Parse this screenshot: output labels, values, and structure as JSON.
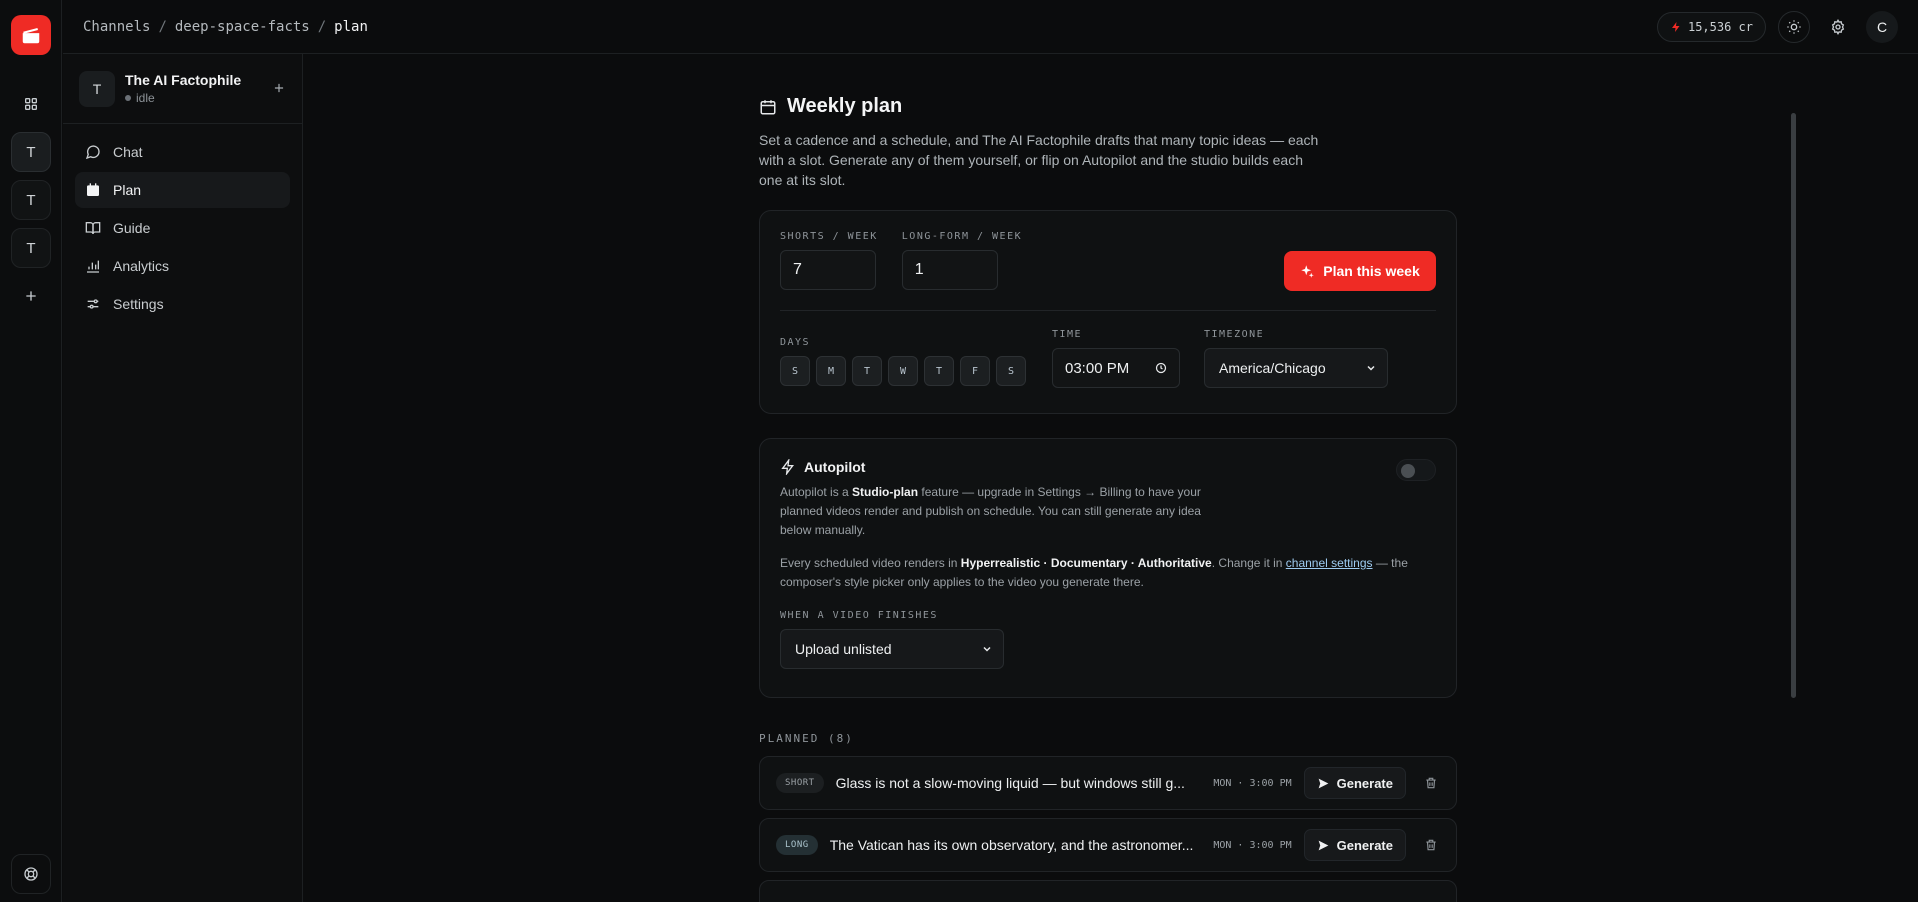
{
  "rail": {
    "items": [
      {
        "label": ""
      },
      {
        "label": "T"
      },
      {
        "label": "T"
      },
      {
        "label": "T"
      }
    ]
  },
  "header": {
    "breadcrumb": [
      "Channels",
      "deep-space-facts",
      "plan"
    ],
    "separator": "/",
    "credits": "15,536 cr",
    "avatar_initial": "C"
  },
  "sidebar": {
    "channel": {
      "initial": "T",
      "name": "The AI Factophile",
      "status": "idle"
    },
    "nav": [
      {
        "label": "Chat",
        "icon": "chat-icon"
      },
      {
        "label": "Plan",
        "icon": "calendar-icon",
        "active": true
      },
      {
        "label": "Guide",
        "icon": "book-icon"
      },
      {
        "label": "Analytics",
        "icon": "bar-chart-icon"
      },
      {
        "label": "Settings",
        "icon": "sliders-icon"
      }
    ]
  },
  "main": {
    "title": "Weekly plan",
    "description": "Set a cadence and a schedule, and The AI Factophile drafts that many topic ideas — each with a slot. Generate any of them yourself, or flip on Autopilot and the studio builds each one at its slot.",
    "cadence": {
      "shorts_label": "SHORTS / WEEK",
      "shorts_value": "7",
      "longform_label": "LONG-FORM / WEEK",
      "longform_value": "1",
      "plan_button": "Plan this week"
    },
    "schedule": {
      "days_label": "DAYS",
      "days": [
        "S",
        "M",
        "T",
        "W",
        "T",
        "F",
        "S"
      ],
      "time_label": "TIME",
      "time_value": "03:00 PM",
      "timezone_label": "TIMEZONE",
      "timezone_value": "America/Chicago"
    },
    "autopilot": {
      "title": "Autopilot",
      "text_pre": "Autopilot is a ",
      "text_bold": "Studio-plan",
      "text_post": " feature — upgrade in Settings → Billing to have your planned videos render and publish on schedule. You can still generate any idea below manually.",
      "style_pre": "Every scheduled video renders in ",
      "style_bold": "Hyperrealistic · Documentary · Authoritative",
      "style_mid": ". Change it in ",
      "style_link": "channel settings",
      "style_post": " — the composer's style picker only applies to the video you generate there.",
      "finish_label": "WHEN A VIDEO FINISHES",
      "finish_value": "Upload unlisted",
      "enabled": false
    },
    "planned": {
      "label": "PLANNED (8)",
      "items": [
        {
          "tag": "SHORT",
          "title": "Glass is not a slow-moving liquid — but windows still g...",
          "time": "MON · 3:00 PM",
          "action": "Generate"
        },
        {
          "tag": "LONG",
          "title": "The Vatican has its own observatory, and the astronomer...",
          "time": "MON · 3:00 PM",
          "action": "Generate"
        }
      ]
    }
  },
  "colors": {
    "accent": "#ef2b25",
    "background": "#0b0c0d",
    "link": "#9ecbf0"
  }
}
